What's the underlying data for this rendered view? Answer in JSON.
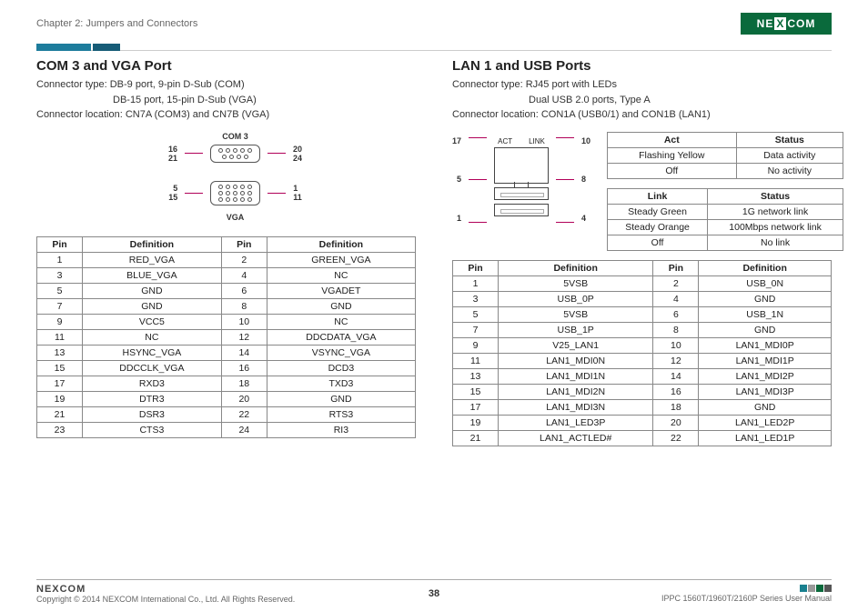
{
  "header": {
    "chapter": "Chapter 2: Jumpers and Connectors",
    "logo": "NEXCOM"
  },
  "left": {
    "title": "COM 3 and VGA Port",
    "meta1": "Connector type: DB-9 port, 9-pin D-Sub (COM)",
    "meta2": "DB-15 port, 15-pin D-Sub (VGA)",
    "meta3": "Connector location: CN7A (COM3) and CN7B (VGA)",
    "diag": {
      "top_label": "COM 3",
      "top_l1": "16",
      "top_l2": "21",
      "top_r1": "20",
      "top_r2": "24",
      "bot_label": "VGA",
      "bot_l1": "5",
      "bot_l2": "15",
      "bot_r1": "1",
      "bot_r2": "11"
    },
    "thead": {
      "pin": "Pin",
      "def": "Definition"
    },
    "rows": [
      {
        "p1": "1",
        "d1": "RED_VGA",
        "p2": "2",
        "d2": "GREEN_VGA"
      },
      {
        "p1": "3",
        "d1": "BLUE_VGA",
        "p2": "4",
        "d2": "NC"
      },
      {
        "p1": "5",
        "d1": "GND",
        "p2": "6",
        "d2": "VGADET"
      },
      {
        "p1": "7",
        "d1": "GND",
        "p2": "8",
        "d2": "GND"
      },
      {
        "p1": "9",
        "d1": "VCC5",
        "p2": "10",
        "d2": "NC"
      },
      {
        "p1": "11",
        "d1": "NC",
        "p2": "12",
        "d2": "DDCDATA_VGA"
      },
      {
        "p1": "13",
        "d1": "HSYNC_VGA",
        "p2": "14",
        "d2": "VSYNC_VGA"
      },
      {
        "p1": "15",
        "d1": "DDCCLK_VGA",
        "p2": "16",
        "d2": "DCD3"
      },
      {
        "p1": "17",
        "d1": "RXD3",
        "p2": "18",
        "d2": "TXD3"
      },
      {
        "p1": "19",
        "d1": "DTR3",
        "p2": "20",
        "d2": "GND"
      },
      {
        "p1": "21",
        "d1": "DSR3",
        "p2": "22",
        "d2": "RTS3"
      },
      {
        "p1": "23",
        "d1": "CTS3",
        "p2": "24",
        "d2": "RI3"
      }
    ]
  },
  "right": {
    "title": "LAN 1 and USB Ports",
    "meta1": "Connector type: RJ45 port with LEDs",
    "meta2": "Dual USB 2.0 ports, Type A",
    "meta3": "Connector location: CON1A (USB0/1) and CON1B (LAN1)",
    "rj45": {
      "act": "ACT",
      "link": "LINK"
    },
    "side": {
      "l1": "17",
      "l2": "5",
      "l3": "1",
      "r1": "10",
      "r2": "8",
      "r3": "4"
    },
    "act_table": {
      "h1": "Act",
      "h2": "Status",
      "rows": [
        {
          "a": "Flashing Yellow",
          "b": "Data activity"
        },
        {
          "a": "Off",
          "b": "No activity"
        }
      ]
    },
    "link_table": {
      "h1": "Link",
      "h2": "Status",
      "rows": [
        {
          "a": "Steady Green",
          "b": "1G network link"
        },
        {
          "a": "Steady Orange",
          "b": "100Mbps network link"
        },
        {
          "a": "Off",
          "b": "No link"
        }
      ]
    },
    "thead": {
      "pin": "Pin",
      "def": "Definition"
    },
    "rows": [
      {
        "p1": "1",
        "d1": "5VSB",
        "p2": "2",
        "d2": "USB_0N"
      },
      {
        "p1": "3",
        "d1": "USB_0P",
        "p2": "4",
        "d2": "GND"
      },
      {
        "p1": "5",
        "d1": "5VSB",
        "p2": "6",
        "d2": "USB_1N"
      },
      {
        "p1": "7",
        "d1": "USB_1P",
        "p2": "8",
        "d2": "GND"
      },
      {
        "p1": "9",
        "d1": "V25_LAN1",
        "p2": "10",
        "d2": "LAN1_MDI0P"
      },
      {
        "p1": "11",
        "d1": "LAN1_MDI0N",
        "p2": "12",
        "d2": "LAN1_MDI1P"
      },
      {
        "p1": "13",
        "d1": "LAN1_MDI1N",
        "p2": "14",
        "d2": "LAN1_MDI2P"
      },
      {
        "p1": "15",
        "d1": "LAN1_MDI2N",
        "p2": "16",
        "d2": "LAN1_MDI3P"
      },
      {
        "p1": "17",
        "d1": "LAN1_MDI3N",
        "p2": "18",
        "d2": "GND"
      },
      {
        "p1": "19",
        "d1": "LAN1_LED3P",
        "p2": "20",
        "d2": "LAN1_LED2P"
      },
      {
        "p1": "21",
        "d1": "LAN1_ACTLED#",
        "p2": "22",
        "d2": "LAN1_LED1P"
      }
    ]
  },
  "footer": {
    "copyright": "Copyright © 2014 NEXCOM International Co., Ltd. All Rights Reserved.",
    "page": "38",
    "manual": "IPPC 1560T/1960T/2160P Series User Manual",
    "logo": "NEXCOM"
  }
}
